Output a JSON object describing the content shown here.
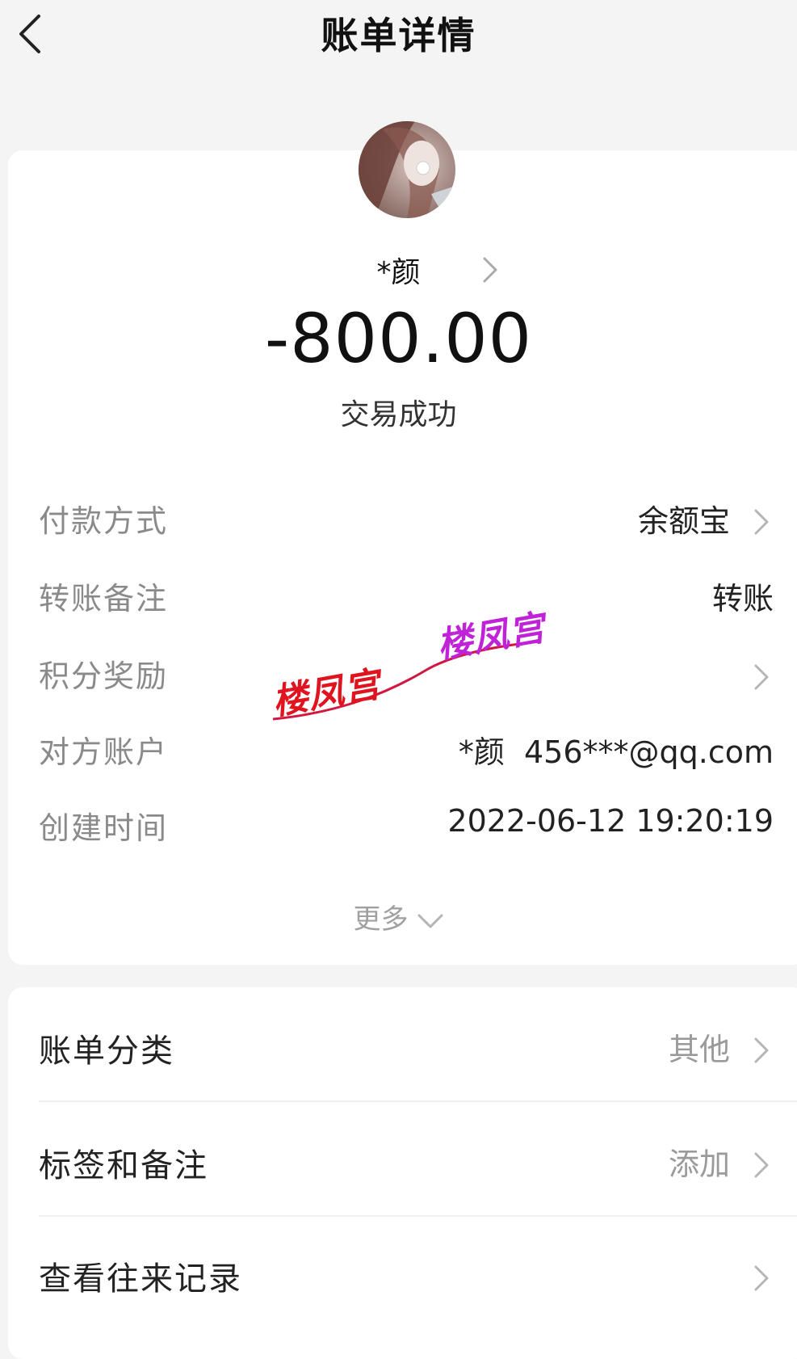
{
  "header": {
    "title": "账单详情",
    "back_icon": "chevron-left-icon"
  },
  "payee": {
    "name": "*颜",
    "avatar_icon": "user-avatar-photo"
  },
  "transaction": {
    "amount": "-800.00",
    "status": "交易成功"
  },
  "details": [
    {
      "label": "付款方式",
      "value": "余额宝",
      "has_chevron": true
    },
    {
      "label": "转账备注",
      "value": "转账",
      "has_chevron": false
    },
    {
      "label": "积分奖励",
      "value": "",
      "has_chevron": true
    },
    {
      "label": "对方账户",
      "value": "*颜  456***@qq.com",
      "has_chevron": false
    },
    {
      "label": "创建时间",
      "value": "2022-06-12 19:20:19",
      "has_chevron": false
    }
  ],
  "more_label": "更多",
  "actions": [
    {
      "label": "账单分类",
      "value": "其他"
    },
    {
      "label": "标签和备注",
      "value": "添加"
    },
    {
      "label": "查看往来记录",
      "value": ""
    }
  ],
  "watermark": {
    "text_left": "楼凤宫",
    "text_right": "楼凤宫",
    "color_left": "#e0141f",
    "color_right": "#c022d8"
  }
}
